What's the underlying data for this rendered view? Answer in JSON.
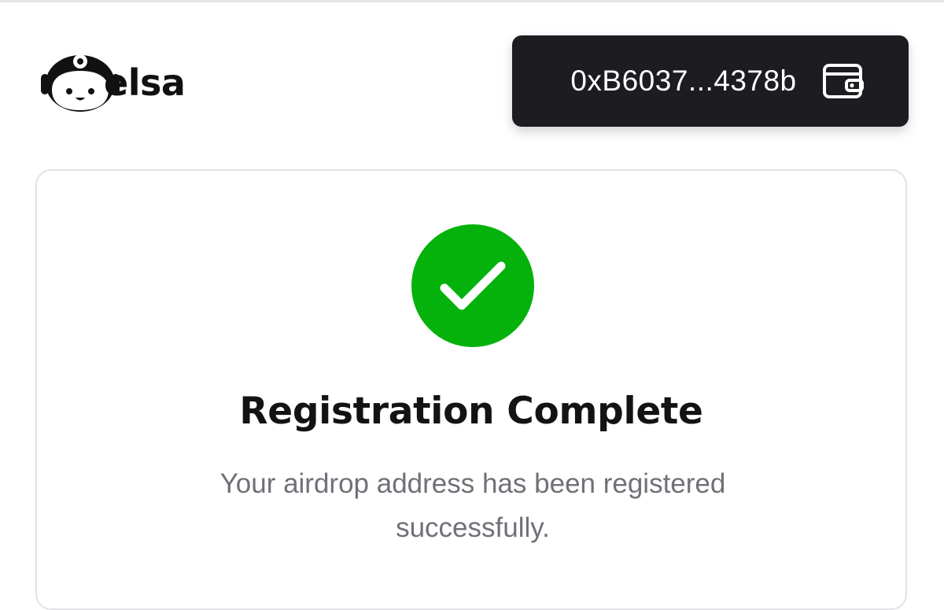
{
  "header": {
    "brand": "elsa",
    "wallet": {
      "address": "0xB6037...4378b",
      "icon": "wallet-icon"
    }
  },
  "status": {
    "icon": "check-circle-icon",
    "color": "#04b20b",
    "title": "Registration Complete",
    "message": "Your airdrop address has been registered successfully."
  }
}
